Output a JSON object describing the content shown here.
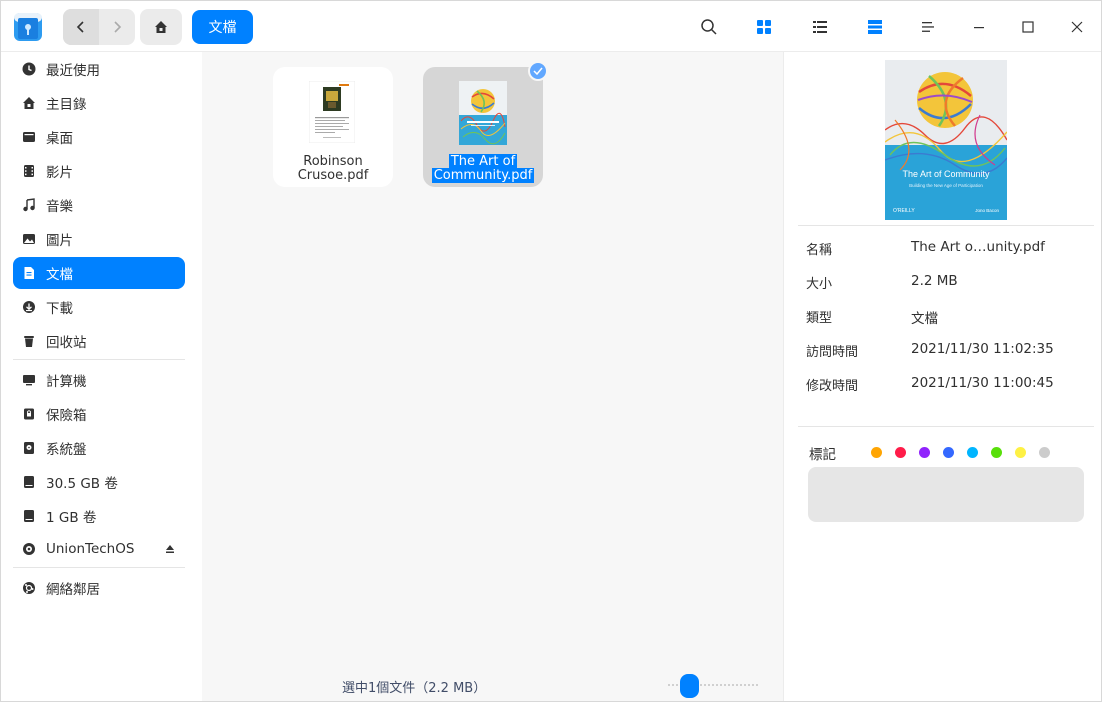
{
  "header": {
    "breadcrumb_label": "文檔"
  },
  "sidebar": {
    "items": [
      {
        "label": "最近使用",
        "icon": "clock-icon"
      },
      {
        "label": "主目錄",
        "icon": "home-icon"
      },
      {
        "label": "桌面",
        "icon": "desktop-icon"
      },
      {
        "label": "影片",
        "icon": "film-icon"
      },
      {
        "label": "音樂",
        "icon": "music-icon"
      },
      {
        "label": "圖片",
        "icon": "picture-icon"
      },
      {
        "label": "文檔",
        "icon": "document-icon"
      },
      {
        "label": "下載",
        "icon": "download-icon"
      },
      {
        "label": "回收站",
        "icon": "trash-icon"
      }
    ],
    "devices": [
      {
        "label": "計算機",
        "icon": "computer-icon"
      },
      {
        "label": "保險箱",
        "icon": "safe-icon"
      },
      {
        "label": "系統盤",
        "icon": "system-disk-icon"
      },
      {
        "label": "30.5 GB 卷",
        "icon": "drive-icon"
      },
      {
        "label": "1 GB 卷",
        "icon": "drive-icon"
      },
      {
        "label": "UnionTechOS",
        "icon": "disc-icon"
      }
    ],
    "network": [
      {
        "label": "網絡鄰居",
        "icon": "network-icon"
      }
    ]
  },
  "files": [
    {
      "line1": "Robinson",
      "line2": "Crusoe.pdf",
      "selected": false
    },
    {
      "line1": "The Art of",
      "line2": "Community.pdf",
      "selected": true
    }
  ],
  "status": {
    "text": "選中1個文件（2.2 MB）",
    "icon_size_level": 0.25
  },
  "detail": {
    "preview_title": "The Art of Community",
    "preview_subtitle": "Building the New Age of Participation",
    "preview_publisher": "O'REILLY",
    "preview_author": "Jono Bacon",
    "rows": [
      {
        "key": "名稱",
        "value": "The Art o…unity.pdf"
      },
      {
        "key": "大小",
        "value": "2.2 MB"
      },
      {
        "key": "類型",
        "value": "文檔"
      },
      {
        "key": "訪問時間",
        "value": "2021/11/30 11:02:35"
      },
      {
        "key": "修改時間",
        "value": "2021/11/30 11:00:45"
      }
    ],
    "tags_label": "標記",
    "tag_colors": [
      "#ffa503",
      "#ff1c49",
      "#9023fc",
      "#3468ff",
      "#00b5ff",
      "#58df0a",
      "#fef144",
      "#cccccc"
    ]
  },
  "colors": {
    "accent": "#0081ff",
    "sidebar_bg": "#ffffff",
    "main_bg": "#f7f7f7"
  }
}
